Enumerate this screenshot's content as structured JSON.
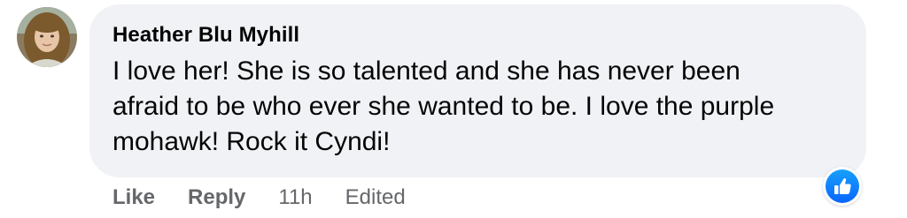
{
  "comment": {
    "author": "Heather Blu Myhill",
    "text": "I love her! She is so talented and she has never been afraid to be who ever she wanted to be. I love the purple mohawk! Rock it Cyndi!",
    "reaction_icon": "thumbs-up-icon",
    "accent_color": "#0866ff",
    "bubble_color": "#f0f2f5"
  },
  "actions": {
    "like_label": "Like",
    "reply_label": "Reply",
    "timestamp": "11h",
    "edited_label": "Edited"
  }
}
